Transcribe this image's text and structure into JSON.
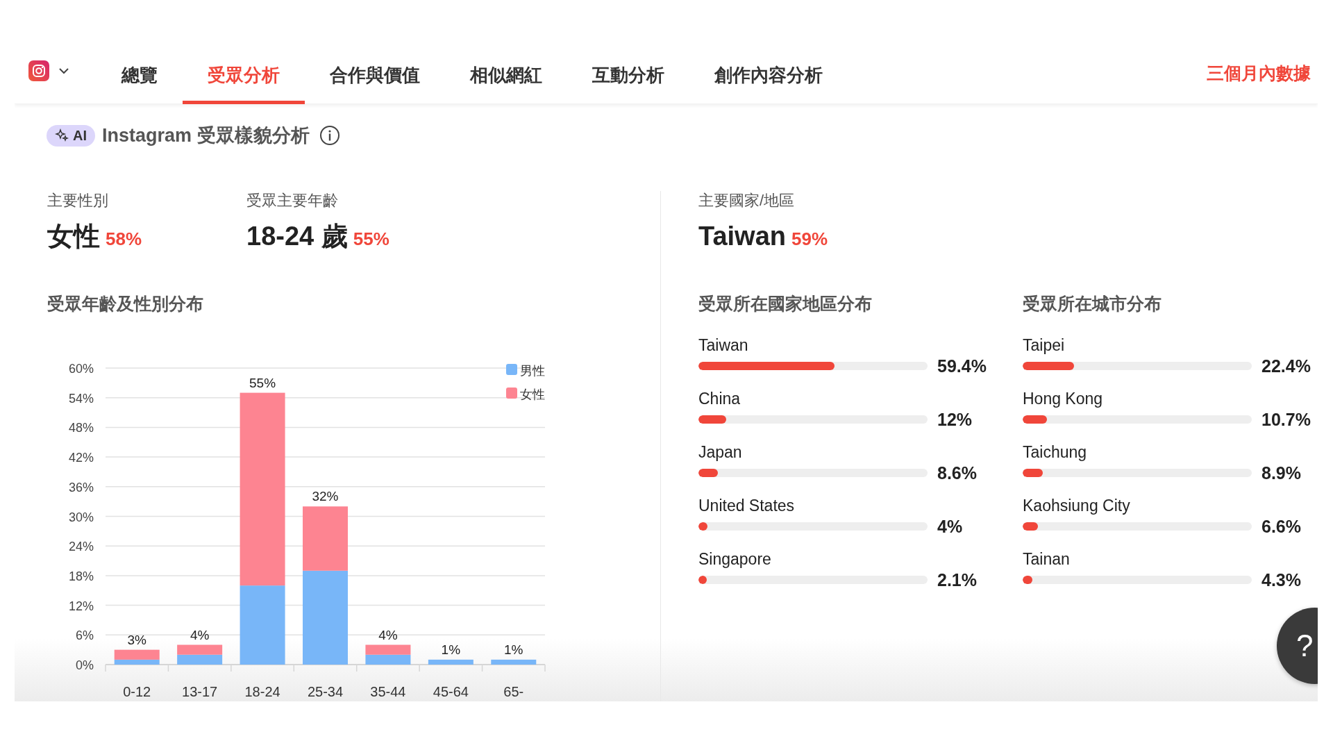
{
  "tabs": [
    {
      "label": "總覽",
      "selected": false
    },
    {
      "label": "受眾分析",
      "selected": true
    },
    {
      "label": "合作與價值",
      "selected": false
    },
    {
      "label": "相似網紅",
      "selected": false
    },
    {
      "label": "互動分析",
      "selected": false
    },
    {
      "label": "創作內容分析",
      "selected": false
    }
  ],
  "period_label": "三個月內數據",
  "header": {
    "badge": "AI",
    "title": "Instagram 受眾樣貌分析"
  },
  "stats": [
    {
      "label": "主要性別",
      "value": "女性",
      "percent": "58%"
    },
    {
      "label": "受眾主要年齡",
      "value": "18-24 歲",
      "percent": "55%"
    },
    {
      "label": "主要國家/地區",
      "value": "Taiwan",
      "percent": "59%"
    }
  ],
  "age_gender": {
    "title": "受眾年齡及性別分布",
    "chart_data": {
      "type": "bar",
      "stacked": true,
      "categories": [
        "0-12",
        "13-17",
        "18-24",
        "25-34",
        "35-44",
        "45-64",
        "65-"
      ],
      "series": [
        {
          "name": "男性",
          "color": "#78b6f8",
          "values": [
            1,
            2,
            16,
            19,
            2,
            1,
            1
          ]
        },
        {
          "name": "女性",
          "color": "#fd8491",
          "values": [
            2,
            2,
            39,
            13,
            2,
            0,
            0
          ]
        }
      ],
      "ylim": [
        0,
        60
      ],
      "grid": true,
      "legend": true,
      "yticks": [
        {
          "value": 0,
          "label": "0%"
        },
        {
          "value": 6,
          "label": "6%"
        },
        {
          "value": 12,
          "label": "12%"
        },
        {
          "value": 18,
          "label": "18%"
        },
        {
          "value": 24,
          "label": "24%"
        },
        {
          "value": 30,
          "label": "30%"
        },
        {
          "value": 36,
          "label": "36%"
        },
        {
          "value": 42,
          "label": "42%"
        },
        {
          "value": 48,
          "label": "48%"
        },
        {
          "value": 54,
          "label": "54%"
        },
        {
          "value": 60,
          "label": "60%"
        }
      ],
      "value_labels": [
        "3%",
        "4%",
        "55%",
        "32%",
        "4%",
        "1%",
        "1%"
      ]
    }
  },
  "countries": {
    "title": "受眾所在國家地區分布",
    "items": [
      {
        "name": "Taiwan",
        "level": 0.594,
        "reading": "59.4%"
      },
      {
        "name": "China",
        "level": 0.12,
        "reading": "12%"
      },
      {
        "name": "Japan",
        "level": 0.086,
        "reading": "8.6%"
      },
      {
        "name": "United States",
        "level": 0.04,
        "reading": "4%"
      },
      {
        "name": "Singapore",
        "level": 0.021,
        "reading": "2.1%"
      }
    ]
  },
  "cities": {
    "title": "受眾所在城市分布",
    "items": [
      {
        "name": "Taipei",
        "level": 0.224,
        "reading": "22.4%"
      },
      {
        "name": "Hong Kong",
        "level": 0.107,
        "reading": "10.7%"
      },
      {
        "name": "Taichung",
        "level": 0.089,
        "reading": "8.9%"
      },
      {
        "name": "Kaohsiung City",
        "level": 0.066,
        "reading": "6.6%"
      },
      {
        "name": "Tainan",
        "level": 0.043,
        "reading": "4.3%"
      }
    ]
  },
  "help_button": {
    "label": "?"
  }
}
